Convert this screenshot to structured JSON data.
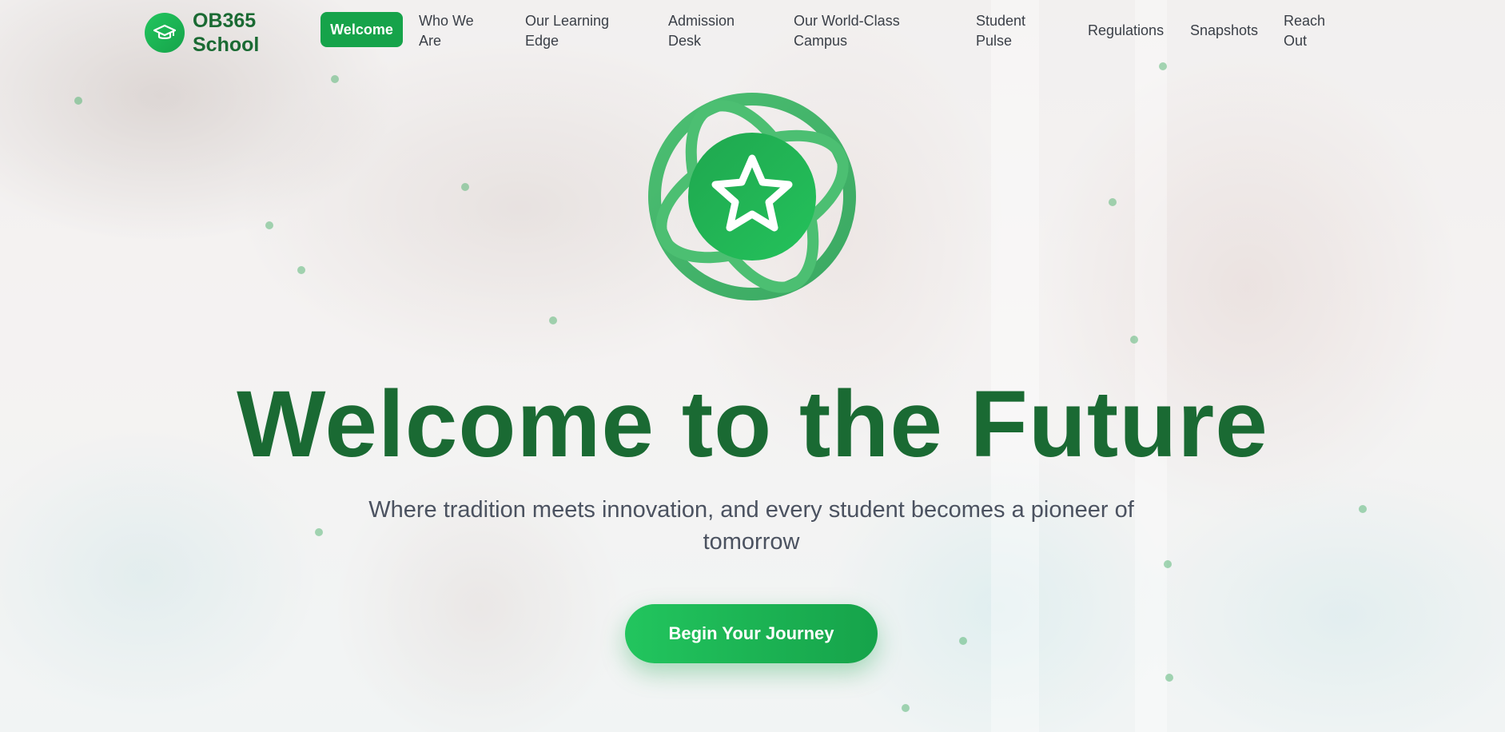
{
  "brand": {
    "name": "OB365 School",
    "logo_icon": "graduation-cap-icon"
  },
  "nav": {
    "active": "Welcome",
    "items": [
      {
        "label": "Who We Are"
      },
      {
        "label": "Our Learning Edge"
      },
      {
        "label": "Admission Desk"
      },
      {
        "label": "Our World-Class Campus"
      },
      {
        "label": "Student Pulse"
      },
      {
        "label": "Regulations"
      },
      {
        "label": "Snapshots"
      },
      {
        "label": "Reach Out"
      }
    ]
  },
  "hero": {
    "emblem_icon": "star-globe-icon",
    "title": "Welcome to the Future",
    "subtitle": "Where tradition meets innovation, and every student becomes a pioneer of tomorrow",
    "cta_label": "Begin Your Journey"
  },
  "colors": {
    "brand_green": "#16a34a",
    "accent_green": "#22c55e",
    "title_green": "#1a6a33"
  }
}
